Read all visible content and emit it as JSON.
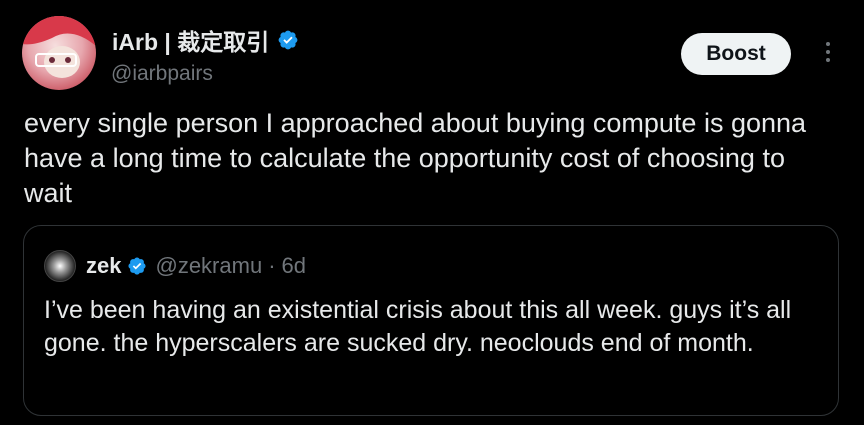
{
  "author": {
    "display_name": "iArb | 裁定取引",
    "handle": "@iarbpairs",
    "avatar_icon": "avatar-anime-icon",
    "verified_icon": "verified-badge-icon"
  },
  "actions": {
    "boost_label": "Boost",
    "more_icon": "more-vertical-icon"
  },
  "tweet": {
    "text": "every single person I approached about buying compute is gonna have a long time to calculate the opportunity cost of choosing to wait"
  },
  "quoted_tweet": {
    "display_name": "zek",
    "handle": "@zekramu",
    "separator": "·",
    "time": "6d",
    "text": "I’ve been having an existential crisis about this all week. guys it’s all gone. the hyperscalers are sucked dry. neoclouds end of month."
  },
  "colors": {
    "background": "#000000",
    "text_primary": "#e7e9ea",
    "text_secondary": "#71767b",
    "verified_blue": "#1d9bf0",
    "border": "#2f3336"
  }
}
